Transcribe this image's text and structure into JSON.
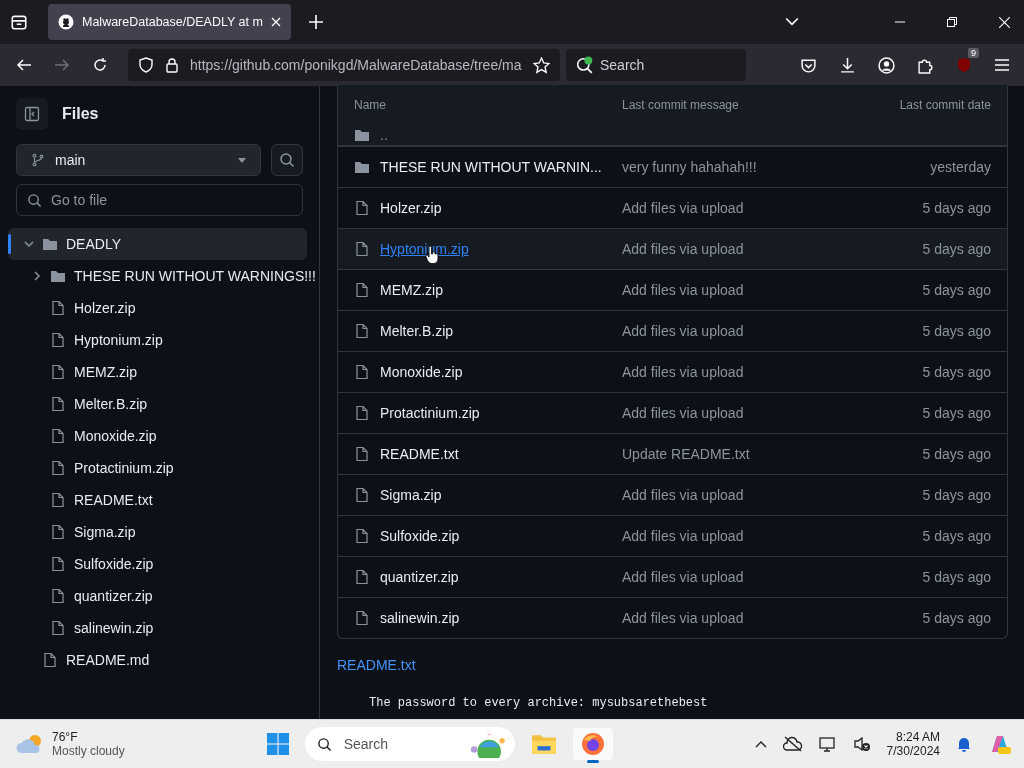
{
  "browser": {
    "tab_title": "MalwareDatabase/DEADLY at m",
    "url": "https://github.com/ponikgd/MalwareDatabase/tree/ma",
    "search_placeholder": "Search",
    "extension_badge": "9"
  },
  "sidebar": {
    "title": "Files",
    "branch": "main",
    "go_to_file_placeholder": "Go to file",
    "tree": [
      {
        "name": "DEADLY",
        "kind": "folder",
        "expanded": true,
        "selected": true,
        "children": [
          {
            "name": "THESE RUN WITHOUT WARNINGS!!!",
            "kind": "folder",
            "expanded": false,
            "selected": false
          },
          {
            "name": "Holzer.zip",
            "kind": "file",
            "selected": false
          },
          {
            "name": "Hyptonium.zip",
            "kind": "file",
            "selected": false
          },
          {
            "name": "MEMZ.zip",
            "kind": "file",
            "selected": false
          },
          {
            "name": "Melter.B.zip",
            "kind": "file",
            "selected": false
          },
          {
            "name": "Monoxide.zip",
            "kind": "file",
            "selected": false
          },
          {
            "name": "Protactinium.zip",
            "kind": "file",
            "selected": false
          },
          {
            "name": "README.txt",
            "kind": "file",
            "selected": false
          },
          {
            "name": "Sigma.zip",
            "kind": "file",
            "selected": false
          },
          {
            "name": "Sulfoxide.zip",
            "kind": "file",
            "selected": false
          },
          {
            "name": "quantizer.zip",
            "kind": "file",
            "selected": false
          },
          {
            "name": "salinewin.zip",
            "kind": "file",
            "selected": false
          }
        ]
      },
      {
        "name": "README.md",
        "kind": "file",
        "selected": false
      }
    ]
  },
  "table": {
    "columns": [
      "Name",
      "Last commit message",
      "Last commit date"
    ],
    "parent_row": "..",
    "rows": [
      {
        "kind": "folder",
        "name": "THESE RUN WITHOUT WARNIN...",
        "message": "very funny hahahah!!!",
        "date": "yesterday",
        "hovered": false
      },
      {
        "kind": "file",
        "name": "Holzer.zip",
        "message": "Add files via upload",
        "date": "5 days ago",
        "hovered": false
      },
      {
        "kind": "file",
        "name": "Hyptonium.zip",
        "message": "Add files via upload",
        "date": "5 days ago",
        "hovered": true
      },
      {
        "kind": "file",
        "name": "MEMZ.zip",
        "message": "Add files via upload",
        "date": "5 days ago",
        "hovered": false
      },
      {
        "kind": "file",
        "name": "Melter.B.zip",
        "message": "Add files via upload",
        "date": "5 days ago",
        "hovered": false
      },
      {
        "kind": "file",
        "name": "Monoxide.zip",
        "message": "Add files via upload",
        "date": "5 days ago",
        "hovered": false
      },
      {
        "kind": "file",
        "name": "Protactinium.zip",
        "message": "Add files via upload",
        "date": "5 days ago",
        "hovered": false
      },
      {
        "kind": "file",
        "name": "README.txt",
        "message": "Update README.txt",
        "date": "5 days ago",
        "hovered": false
      },
      {
        "kind": "file",
        "name": "Sigma.zip",
        "message": "Add files via upload",
        "date": "5 days ago",
        "hovered": false
      },
      {
        "kind": "file",
        "name": "Sulfoxide.zip",
        "message": "Add files via upload",
        "date": "5 days ago",
        "hovered": false
      },
      {
        "kind": "file",
        "name": "quantizer.zip",
        "message": "Add files via upload",
        "date": "5 days ago",
        "hovered": false
      },
      {
        "kind": "file",
        "name": "salinewin.zip",
        "message": "Add files via upload",
        "date": "5 days ago",
        "hovered": false
      }
    ]
  },
  "readme": {
    "title": "README.txt",
    "text": "The password to every archive: mysubsarethebest"
  },
  "taskbar": {
    "temperature": "76°F",
    "condition": "Mostly cloudy",
    "search_placeholder": "Search",
    "time": "8:24 AM",
    "date": "7/30/2024"
  }
}
